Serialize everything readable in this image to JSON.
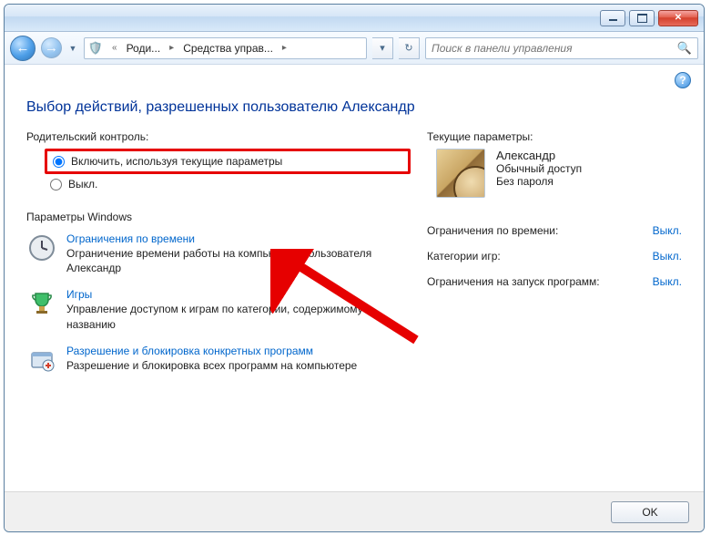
{
  "breadcrumb": {
    "level1": "Роди...",
    "level2": "Средства управ..."
  },
  "search": {
    "placeholder": "Поиск в панели управления"
  },
  "page_title": "Выбор действий, разрешенных пользователю Александр",
  "parental": {
    "head": "Родительский контроль:",
    "on_label": "Включить, используя текущие параметры",
    "off_label": "Выкл."
  },
  "params_head": "Параметры Windows",
  "options": {
    "time": {
      "title": "Ограничения по времени",
      "desc": "Ограничение времени работы на компьютере пользователя Александр"
    },
    "games": {
      "title": "Игры",
      "desc": "Управление доступом к играм по категории, содержимому и названию"
    },
    "apps": {
      "title": "Разрешение и блокировка конкретных программ",
      "desc": "Разрешение и блокировка всех программ на компьютере"
    }
  },
  "current": {
    "head": "Текущие параметры:",
    "user_name": "Александр",
    "user_role": "Обычный доступ",
    "user_pass": "Без пароля",
    "rows": {
      "time_label": "Ограничения по времени:",
      "time_val": "Выкл.",
      "game_label": "Категории игр:",
      "game_val": "Выкл.",
      "app_label": "Ограничения на запуск программ:",
      "app_val": "Выкл."
    }
  },
  "footer": {
    "ok": "OK"
  }
}
